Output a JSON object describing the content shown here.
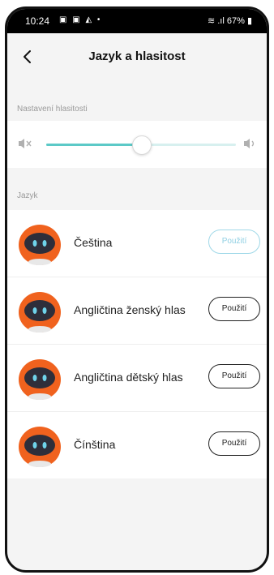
{
  "status_bar": {
    "time": "10:24",
    "left_icons": "▣ ▣ ◭ •",
    "right": "67%"
  },
  "header": {
    "title": "Jazyk a hlasitost"
  },
  "volume": {
    "section_label": "Nastavení hlasitosti",
    "level_percent": 50
  },
  "language": {
    "section_label": "Jazyk",
    "items": [
      {
        "name": "Čeština",
        "button": "Použití",
        "active": true
      },
      {
        "name": "Angličtina ženský hlas",
        "button": "Použití",
        "active": false
      },
      {
        "name": "Angličtina dětský hlas",
        "button": "Použití",
        "active": false
      },
      {
        "name": "Čínština",
        "button": "Použití",
        "active": false
      }
    ]
  },
  "colors": {
    "accent": "#5cc9c7",
    "active_button": "#9fd8e8",
    "avatar": "#f0621e"
  }
}
